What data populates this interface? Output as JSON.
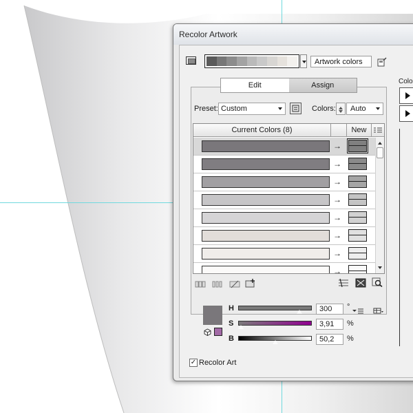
{
  "dialog": {
    "title": "Recolor Artwork",
    "color_group_strip": [
      "#5a5a5a",
      "#777777",
      "#8c8c8c",
      "#a3a3a3",
      "#bababa",
      "#c9c9c9",
      "#d8d6d3",
      "#e6e2dd",
      "#f3f1ee"
    ],
    "artwork_colors_field": "Artwork colors",
    "side_label": "Colo",
    "tabs": [
      {
        "label": "Edit",
        "active": true
      },
      {
        "label": "Assign",
        "active": false
      }
    ],
    "preset": {
      "label": "Preset:",
      "value": "Custom"
    },
    "colors": {
      "label": "Colors:",
      "value": "Auto"
    },
    "table": {
      "current_header": "Current Colors (8)",
      "new_header": "New",
      "rows": [
        {
          "current": "#7a777b",
          "arrow": "→",
          "new": "#808080",
          "selected": true
        },
        {
          "current": "#807d81",
          "arrow": "→",
          "new": "#8a8a8a",
          "selected": false
        },
        {
          "current": "#a19fa2",
          "arrow": "→",
          "new": "#a5a5a5",
          "selected": false
        },
        {
          "current": "#c6c5c7",
          "arrow": "→",
          "new": "#c4c4c4",
          "selected": false
        },
        {
          "current": "#d5d4d6",
          "arrow": "→",
          "new": "#d2d2d2",
          "selected": false
        },
        {
          "current": "#e2ddd9",
          "arrow": "→",
          "new": "#e0e0e0",
          "selected": false
        },
        {
          "current": "#f0edea",
          "arrow": "→",
          "new": "#ededed",
          "selected": false
        },
        {
          "current": "#fbfaf9",
          "arrow": "→",
          "new": "#fafafa",
          "selected": false
        }
      ]
    },
    "edit_color": {
      "swatch": "#7a777b",
      "mini_swatch": "#a26aa6",
      "hsb": [
        {
          "label": "H",
          "value": "300",
          "unit": "°",
          "level": 0.83,
          "gradient": "linear-gradient(90deg,#7a7a7a,#7a7a7a)"
        },
        {
          "label": "S",
          "value": "3,91",
          "unit": "%",
          "level": 0.04,
          "gradient": "linear-gradient(90deg,#7a7a7a,#900090)"
        },
        {
          "label": "B",
          "value": "50,2",
          "unit": "%",
          "level": 0.5,
          "gradient": "linear-gradient(90deg,#000000,#ffffff)"
        }
      ]
    },
    "recolor_art": {
      "label": "Recolor Art",
      "checked": true,
      "check_glyph": "✓"
    }
  }
}
